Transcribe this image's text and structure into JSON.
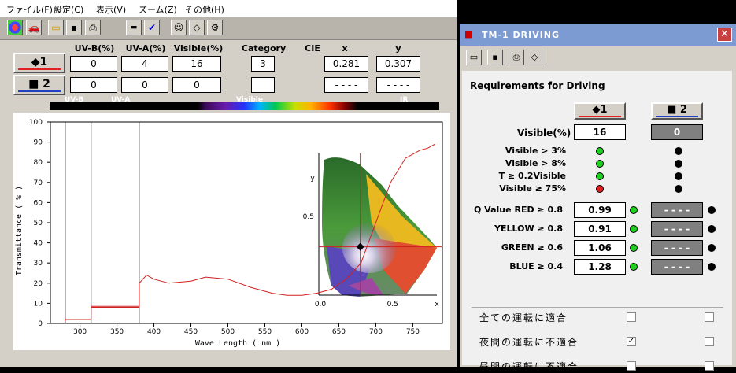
{
  "menu": [
    "ファイル(F)",
    "設定(C)",
    "表示(V)",
    "ズーム(Z)",
    "その他(H)"
  ],
  "headers": {
    "uvb": "UV-B(%)",
    "uva": "UV-A(%)",
    "visible": "Visible(%)",
    "category": "Category",
    "cie": "CIE",
    "x": "x",
    "y": "y"
  },
  "sample1": {
    "label": "◆1",
    "uvb": "0",
    "uva": "4",
    "visible": "16",
    "category": "3",
    "x": "0.281",
    "y": "0.307",
    "underline_color": "#e02020"
  },
  "sample2": {
    "label": "■ 2",
    "uvb": "0",
    "uva": "0",
    "visible": "0",
    "category": "",
    "x": "- - - -",
    "y": "- - - -",
    "underline_color": "#2040c0"
  },
  "spectrum_labels": {
    "uvb": "UV-B",
    "uva": "UV-A",
    "visible": "Visible",
    "ir": "IR"
  },
  "chart_data": {
    "type": "line",
    "xlabel": "Wave Length ( nm )",
    "ylabel": "Transmittance ( % )",
    "xlim": [
      260,
      790
    ],
    "ylim": [
      0,
      100
    ],
    "x_ticks": [
      300,
      350,
      400,
      450,
      500,
      550,
      600,
      650,
      700,
      750
    ],
    "y_ticks": [
      0,
      10,
      20,
      30,
      40,
      50,
      60,
      70,
      80,
      90,
      100
    ],
    "band_lines": [
      280,
      315,
      380
    ],
    "series": [
      {
        "x": [
          280,
          280,
          315,
          315,
          380,
          380,
          390,
          400,
          420,
          450,
          470,
          500,
          530,
          560,
          580,
          600,
          620,
          640,
          660,
          680,
          700,
          720,
          740,
          760,
          770,
          780
        ],
        "y": [
          1,
          2,
          2,
          8,
          8,
          20,
          24,
          22,
          20,
          21,
          23,
          22,
          18,
          15,
          14,
          14,
          15,
          17,
          22,
          30,
          50,
          70,
          82,
          86,
          87,
          89
        ]
      }
    ],
    "band_steps": [
      {
        "x": [
          280,
          315
        ],
        "y": [
          2,
          2
        ]
      },
      {
        "x": [
          315,
          380
        ],
        "y": [
          8.5,
          8.5
        ]
      }
    ],
    "cie_inset": {
      "xlim": [
        0,
        0.8
      ],
      "ylim": [
        0,
        0.9
      ],
      "x_ticks": [
        "0.0",
        "0.5"
      ],
      "y_ticks": [
        "0.5"
      ],
      "x_axis_label": "x",
      "y_axis_label": "y",
      "point": {
        "x": 0.281,
        "y": 0.307
      }
    }
  },
  "dialog": {
    "title": "TM-1 DRIVING",
    "heading": "Requirements for Driving",
    "btn1": "◆1",
    "btn2": "■ 2",
    "visible_label": "Visible(%)",
    "visible1": "16",
    "visible2": "0",
    "criteria": [
      {
        "label": "Visible > 3%",
        "s1": "#20d020",
        "s2": "#000000"
      },
      {
        "label": "Visible > 8%",
        "s1": "#20d020",
        "s2": "#000000"
      },
      {
        "label": "T ≥ 0.2Visible",
        "s1": "#20d020",
        "s2": "#000000"
      },
      {
        "label": "Visible ≥ 75%",
        "s1": "#e02020",
        "s2": "#000000"
      }
    ],
    "qvalue_label": "Q Value",
    "qvalues": [
      {
        "label": "RED ≥ 0.8",
        "v1": "0.99",
        "v2": "- - - -"
      },
      {
        "label": "YELLOW ≥ 0.8",
        "v1": "0.91",
        "v2": "- - - -"
      },
      {
        "label": "GREEN ≥ 0.6",
        "v1": "1.06",
        "v2": "- - - -"
      },
      {
        "label": "BLUE ≥ 0.4",
        "v1": "1.28",
        "v2": "- - - -"
      }
    ],
    "checks": [
      {
        "label": "全ての運転に適合",
        "c1": "",
        "c2": ""
      },
      {
        "label": "夜間の運転に不適合",
        "c1": "✓",
        "c2": ""
      },
      {
        "label": "昼間の運転に不適合",
        "c1": "",
        "c2": ""
      }
    ]
  }
}
